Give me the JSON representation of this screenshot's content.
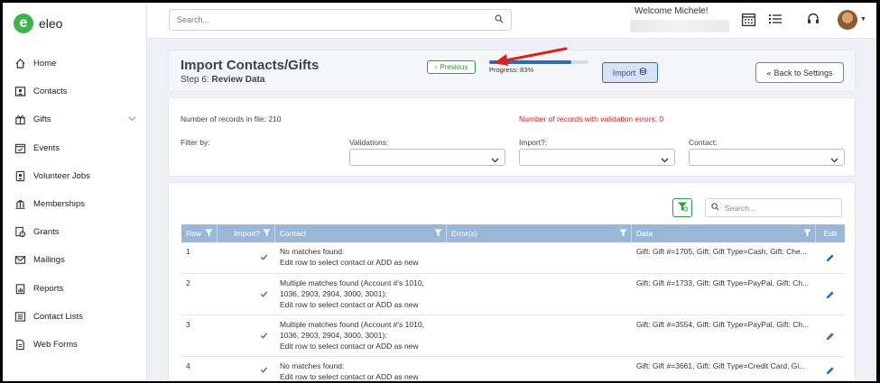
{
  "brand": {
    "name": "eleo",
    "logo_letter": "e",
    "color": "#3cb44b"
  },
  "sidebar": {
    "items": [
      {
        "label": "Home",
        "icon": "home-icon"
      },
      {
        "label": "Contacts",
        "icon": "contacts-icon"
      },
      {
        "label": "Gifts",
        "icon": "gift-icon",
        "has_chevron": true
      },
      {
        "label": "Events",
        "icon": "calendar-check-icon"
      },
      {
        "label": "Volunteer Jobs",
        "icon": "volunteer-icon"
      },
      {
        "label": "Memberships",
        "icon": "building-icon"
      },
      {
        "label": "Grants",
        "icon": "grants-icon"
      },
      {
        "label": "Mailings",
        "icon": "envelope-icon"
      },
      {
        "label": "Reports",
        "icon": "reports-icon"
      },
      {
        "label": "Contact Lists",
        "icon": "list-icon"
      },
      {
        "label": "Web Forms",
        "icon": "document-icon"
      }
    ]
  },
  "topbar": {
    "search_placeholder": "Search...",
    "welcome": "Welcome Michele!"
  },
  "header": {
    "title": "Import Contacts/Gifts",
    "step_prefix": "Step 6:",
    "step_name": "Review Data",
    "previous_label": "Previous",
    "progress_label": "Progress: 83%",
    "progress_value": 0.83,
    "import_label": "Import",
    "back_label": "Back to Settings"
  },
  "filters": {
    "records_in_file": "Number of records in file: 210",
    "validation_errors": "Number of records with validation errors: 0",
    "filter_by": "Filter by:",
    "validations_label": "Validations:",
    "import_label": "Import?:",
    "contact_label": "Contact:"
  },
  "table": {
    "search_placeholder": "Search...",
    "columns": [
      "Row",
      "Import?",
      "Contact",
      "Error(s)",
      "Data",
      "Edit"
    ],
    "rows": [
      {
        "row": "1",
        "import": true,
        "contact_lines": [
          "No matches found:",
          "Edit row to select contact or ADD as new"
        ],
        "errors": "",
        "data": "Gift: Gift #=1705, Gift: Gift Type=Cash, Gift: Che..."
      },
      {
        "row": "2",
        "import": true,
        "contact_lines": [
          "Multiple matches found (Account #'s 1010,",
          "1036, 2903, 2904, 3000, 3001):",
          "Edit row to select contact or ADD as new"
        ],
        "errors": "",
        "data": "Gift: Gift #=1733, Gift: Gift Type=PayPal, Gift: Ch..."
      },
      {
        "row": "3",
        "import": true,
        "contact_lines": [
          "Multiple matches found (Account #'s 1010,",
          "1036, 2903, 2904, 3000, 3001):",
          "Edit row to select contact or ADD as new"
        ],
        "errors": "",
        "data": "Gift: Gift #=3554, Gift: Gift Type=PayPal, Gift: Ch..."
      },
      {
        "row": "4",
        "import": true,
        "contact_lines": [
          "No matches found:",
          "Edit row to select contact or ADD as new"
        ],
        "errors": "",
        "data": "Gift: Gift #=3661, Gift: Gift Type=Credit Card, Gi..."
      }
    ]
  },
  "colors": {
    "accent": "#2d6bb5",
    "error": "#e0201a",
    "success": "#2e9b45",
    "table_header": "#9bb7d6"
  }
}
